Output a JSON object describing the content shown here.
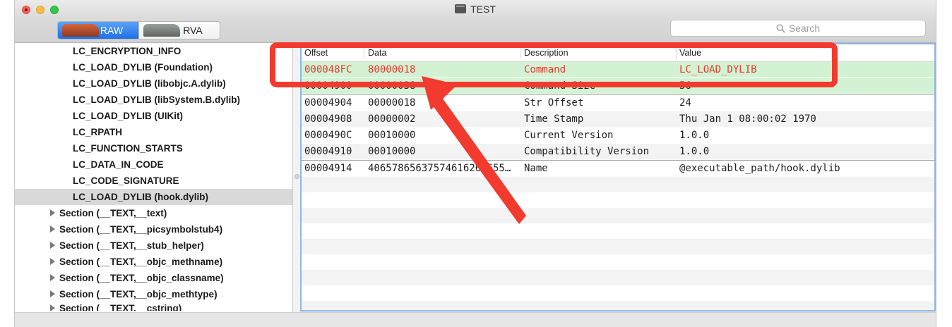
{
  "window": {
    "title": "TEST"
  },
  "toolbar": {
    "modes": [
      "RAW",
      "RVA"
    ],
    "active_mode": "RAW",
    "search_placeholder": "Search"
  },
  "tree": {
    "load_commands": [
      "LC_ENCRYPTION_INFO",
      "LC_LOAD_DYLIB (Foundation)",
      "LC_LOAD_DYLIB (libobjc.A.dylib)",
      "LC_LOAD_DYLIB (libSystem.B.dylib)",
      "LC_LOAD_DYLIB (UIKit)",
      "LC_RPATH",
      "LC_FUNCTION_STARTS",
      "LC_DATA_IN_CODE",
      "LC_CODE_SIGNATURE",
      "LC_LOAD_DYLIB (hook.dylib)"
    ],
    "selected": "LC_LOAD_DYLIB (hook.dylib)",
    "sections": [
      "Section (__TEXT,__text)",
      "Section (__TEXT,__picsymbolstub4)",
      "Section (__TEXT,__stub_helper)",
      "Section (__TEXT,__objc_methname)",
      "Section (__TEXT,__objc_classname)",
      "Section (__TEXT,__objc_methtype)",
      "Section (__TEXT,__cstring)"
    ]
  },
  "table": {
    "columns": [
      "Offset",
      "Data",
      "Description",
      "Value"
    ],
    "rows": [
      [
        "000048FC",
        "80000018",
        "Command",
        "LC_LOAD_DYLIB"
      ],
      [
        "00004900",
        "00000038",
        "Command Size",
        "56"
      ],
      [
        "00004904",
        "00000018",
        "Str Offset",
        "24"
      ],
      [
        "00004908",
        "00000002",
        "Time Stamp",
        "Thu Jan  1 08:00:02 1970"
      ],
      [
        "0000490C",
        "00010000",
        "Current Version",
        "1.0.0"
      ],
      [
        "00004910",
        "00010000",
        "Compatibility Version",
        "1.0.0"
      ],
      [
        "00004914",
        "4065786563757461626C655…",
        "Name",
        "@executable_path/hook.dylib"
      ]
    ]
  },
  "annotation": {
    "color": "#f33a2e"
  }
}
